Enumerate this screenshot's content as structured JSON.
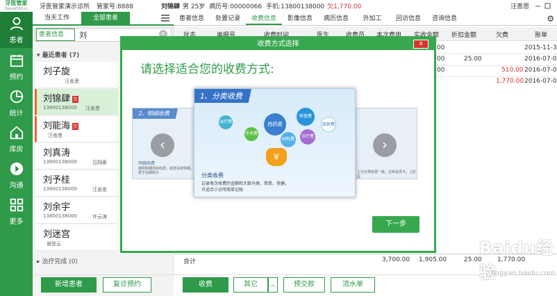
{
  "app": {
    "logo_name": "牙医管家",
    "logo_url_text": "Dental360.cn",
    "clinic": "牙医管家演示诊所",
    "account": "管家号:8888"
  },
  "patient_bar": {
    "name": "刘锦肆",
    "gender_age": "男 25岁",
    "record": "病历号:00000066",
    "phone": "手机:13800138000",
    "owe": "欠1,770.00",
    "operator": "汪善思"
  },
  "sidebar": [
    {
      "label": "患者",
      "icon": "user-icon"
    },
    {
      "label": "预约",
      "icon": "calendar-icon"
    },
    {
      "label": "统计",
      "icon": "pie-chart-icon"
    },
    {
      "label": "库房",
      "icon": "home-icon"
    },
    {
      "label": "沟通",
      "icon": "play-icon"
    },
    {
      "label": "更多",
      "icon": "grid-icon"
    }
  ],
  "left_tabs": [
    "当天工作",
    "全部患者"
  ],
  "search": {
    "field": "患者信息",
    "value": "刘"
  },
  "groups": {
    "recent": "最近患者 (7)",
    "done": "治疗完成 (0)"
  },
  "patients": [
    {
      "name": "刘子旋",
      "tag": "",
      "phone": "",
      "doctor": "汪善思"
    },
    {
      "name": "刘锦肆",
      "tag": "欠",
      "phone": "13800138000",
      "doctor": "汪善思"
    },
    {
      "name": "刘能海",
      "tag": "欠",
      "phone": "",
      "doctor": "汪善思"
    },
    {
      "name": "刘真涛",
      "tag": "",
      "phone": "13800138000",
      "doctor": "吕翔豪"
    },
    {
      "name": "刘予桂",
      "tag": "",
      "phone": "13800138000",
      "doctor": "汪善思"
    },
    {
      "name": "刘余宇",
      "tag": "",
      "phone": "13800138000",
      "doctor": "许云涛"
    },
    {
      "name": "刘迷宫",
      "tag": "",
      "phone": "",
      "doctor": "谢登云"
    }
  ],
  "left_buttons": {
    "add": "新增患者",
    "revisit": "复诊预约"
  },
  "main_tabs": [
    "患者信息",
    "处置记录",
    "收费信息",
    "影像信息",
    "病历信息",
    "外加工",
    "回访信息",
    "咨询信息"
  ],
  "table": {
    "headers": [
      "状态",
      "单据号",
      "收费时间",
      "医生",
      "收费员",
      "本次费用",
      "实收金额",
      "折扣金额",
      "欠费",
      "账单"
    ],
    "rows": [
      {
        "discount": "",
        "owe": "",
        "date": "2015-11-3"
      },
      {
        "discount": "25.00",
        "owe": "",
        "date": "2016-07-0"
      },
      {
        "discount": "",
        "owe": "510.00",
        "date": "2016-07-0"
      },
      {
        "discount": "",
        "owe": "1,770.00",
        "date": "2016-07-0"
      }
    ],
    "paid_suffix": [
      ".00",
      ".00",
      ".00"
    ],
    "total_label": "合计",
    "total_fee": "3,700.00",
    "total_paid": "1,905.00",
    "total_discount": "25.00",
    "total_owe": "1,770.00"
  },
  "main_buttons": {
    "charge": "收费",
    "other": "其它",
    "prepay": "预交款",
    "flow": "流水单"
  },
  "modal": {
    "title": "收费方式选择",
    "close": "x",
    "heading": "请选择适合您的收费方式:",
    "center": {
      "ribbon": "1、分类收费",
      "caption": "分类收费",
      "desc1": "记录每次收费的金额和大致分类，简单、快捷，",
      "desc2": "只适合小诊所简单记帐",
      "clouds": [
        "西药费",
        "检查费",
        "材料费",
        "手术费",
        "诊疗费",
        "治疗费",
        "放射费"
      ],
      "bag": "¥"
    },
    "left": {
      "ribbon": "2、明细收费",
      "caption": "明细收费",
      "desc": "按照明细项目收费，收费清单明细，便于后期统计"
    },
    "right": {
      "desc": "上与分类收费一致，达到会员卡，上阶段"
    },
    "next": "下一步"
  },
  "watermark": {
    "text": "Baidu经验",
    "sub": "jingyan.baidu.com"
  }
}
